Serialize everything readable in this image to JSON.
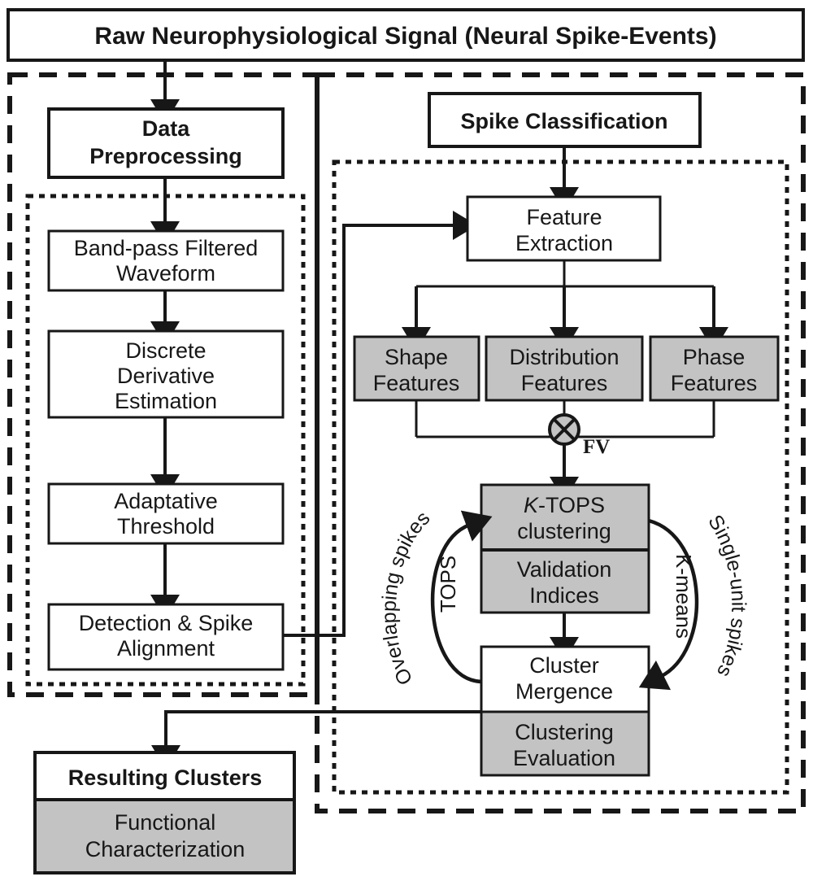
{
  "diagram": {
    "title": "Raw Neurophysiological Signal (Neural Spike-Events)",
    "left_branch": {
      "header": {
        "line1": "Data",
        "line2": "Preprocessing"
      },
      "steps": [
        {
          "line1": "Band-pass Filtered",
          "line2": "Waveform"
        },
        {
          "line1": "Discrete",
          "line2": "Derivative",
          "line3": "Estimation"
        },
        {
          "line1": "Adaptative",
          "line2": "Threshold"
        },
        {
          "line1": "Detection & Spike",
          "line2": "Alignment"
        }
      ]
    },
    "right_branch": {
      "header": "Spike Classification",
      "feature_extraction": {
        "line1": "Feature",
        "line2": "Extraction"
      },
      "features": [
        {
          "line1": "Shape",
          "line2": "Features"
        },
        {
          "line1": "Distribution",
          "line2": "Features"
        },
        {
          "line1": "Phase",
          "line2": "Features"
        }
      ],
      "merge_label": "FV",
      "merge_icon": "circle-cross-icon",
      "clustering": {
        "top_italic": "K",
        "top_rest": "-TOPS",
        "top_line2": "clustering",
        "bottom_line1": "Validation",
        "bottom_line2": "Indices"
      },
      "mergence": {
        "top_line1": "Cluster",
        "top_line2": "Mergence",
        "bottom_line1": "Clustering",
        "bottom_line2": "Evaluation"
      },
      "loop_left": {
        "outer": "Overlapping spikes",
        "inner": "TOPS"
      },
      "loop_right": {
        "outer": "Single-unit spikes",
        "inner": "K-means"
      }
    },
    "output": {
      "header": "Resulting Clusters",
      "body_line1": "Functional",
      "body_line2": "Characterization"
    },
    "colors": {
      "gray_fill": "#c3c3c3",
      "white_fill": "#ffffff",
      "stroke": "#171717"
    }
  }
}
